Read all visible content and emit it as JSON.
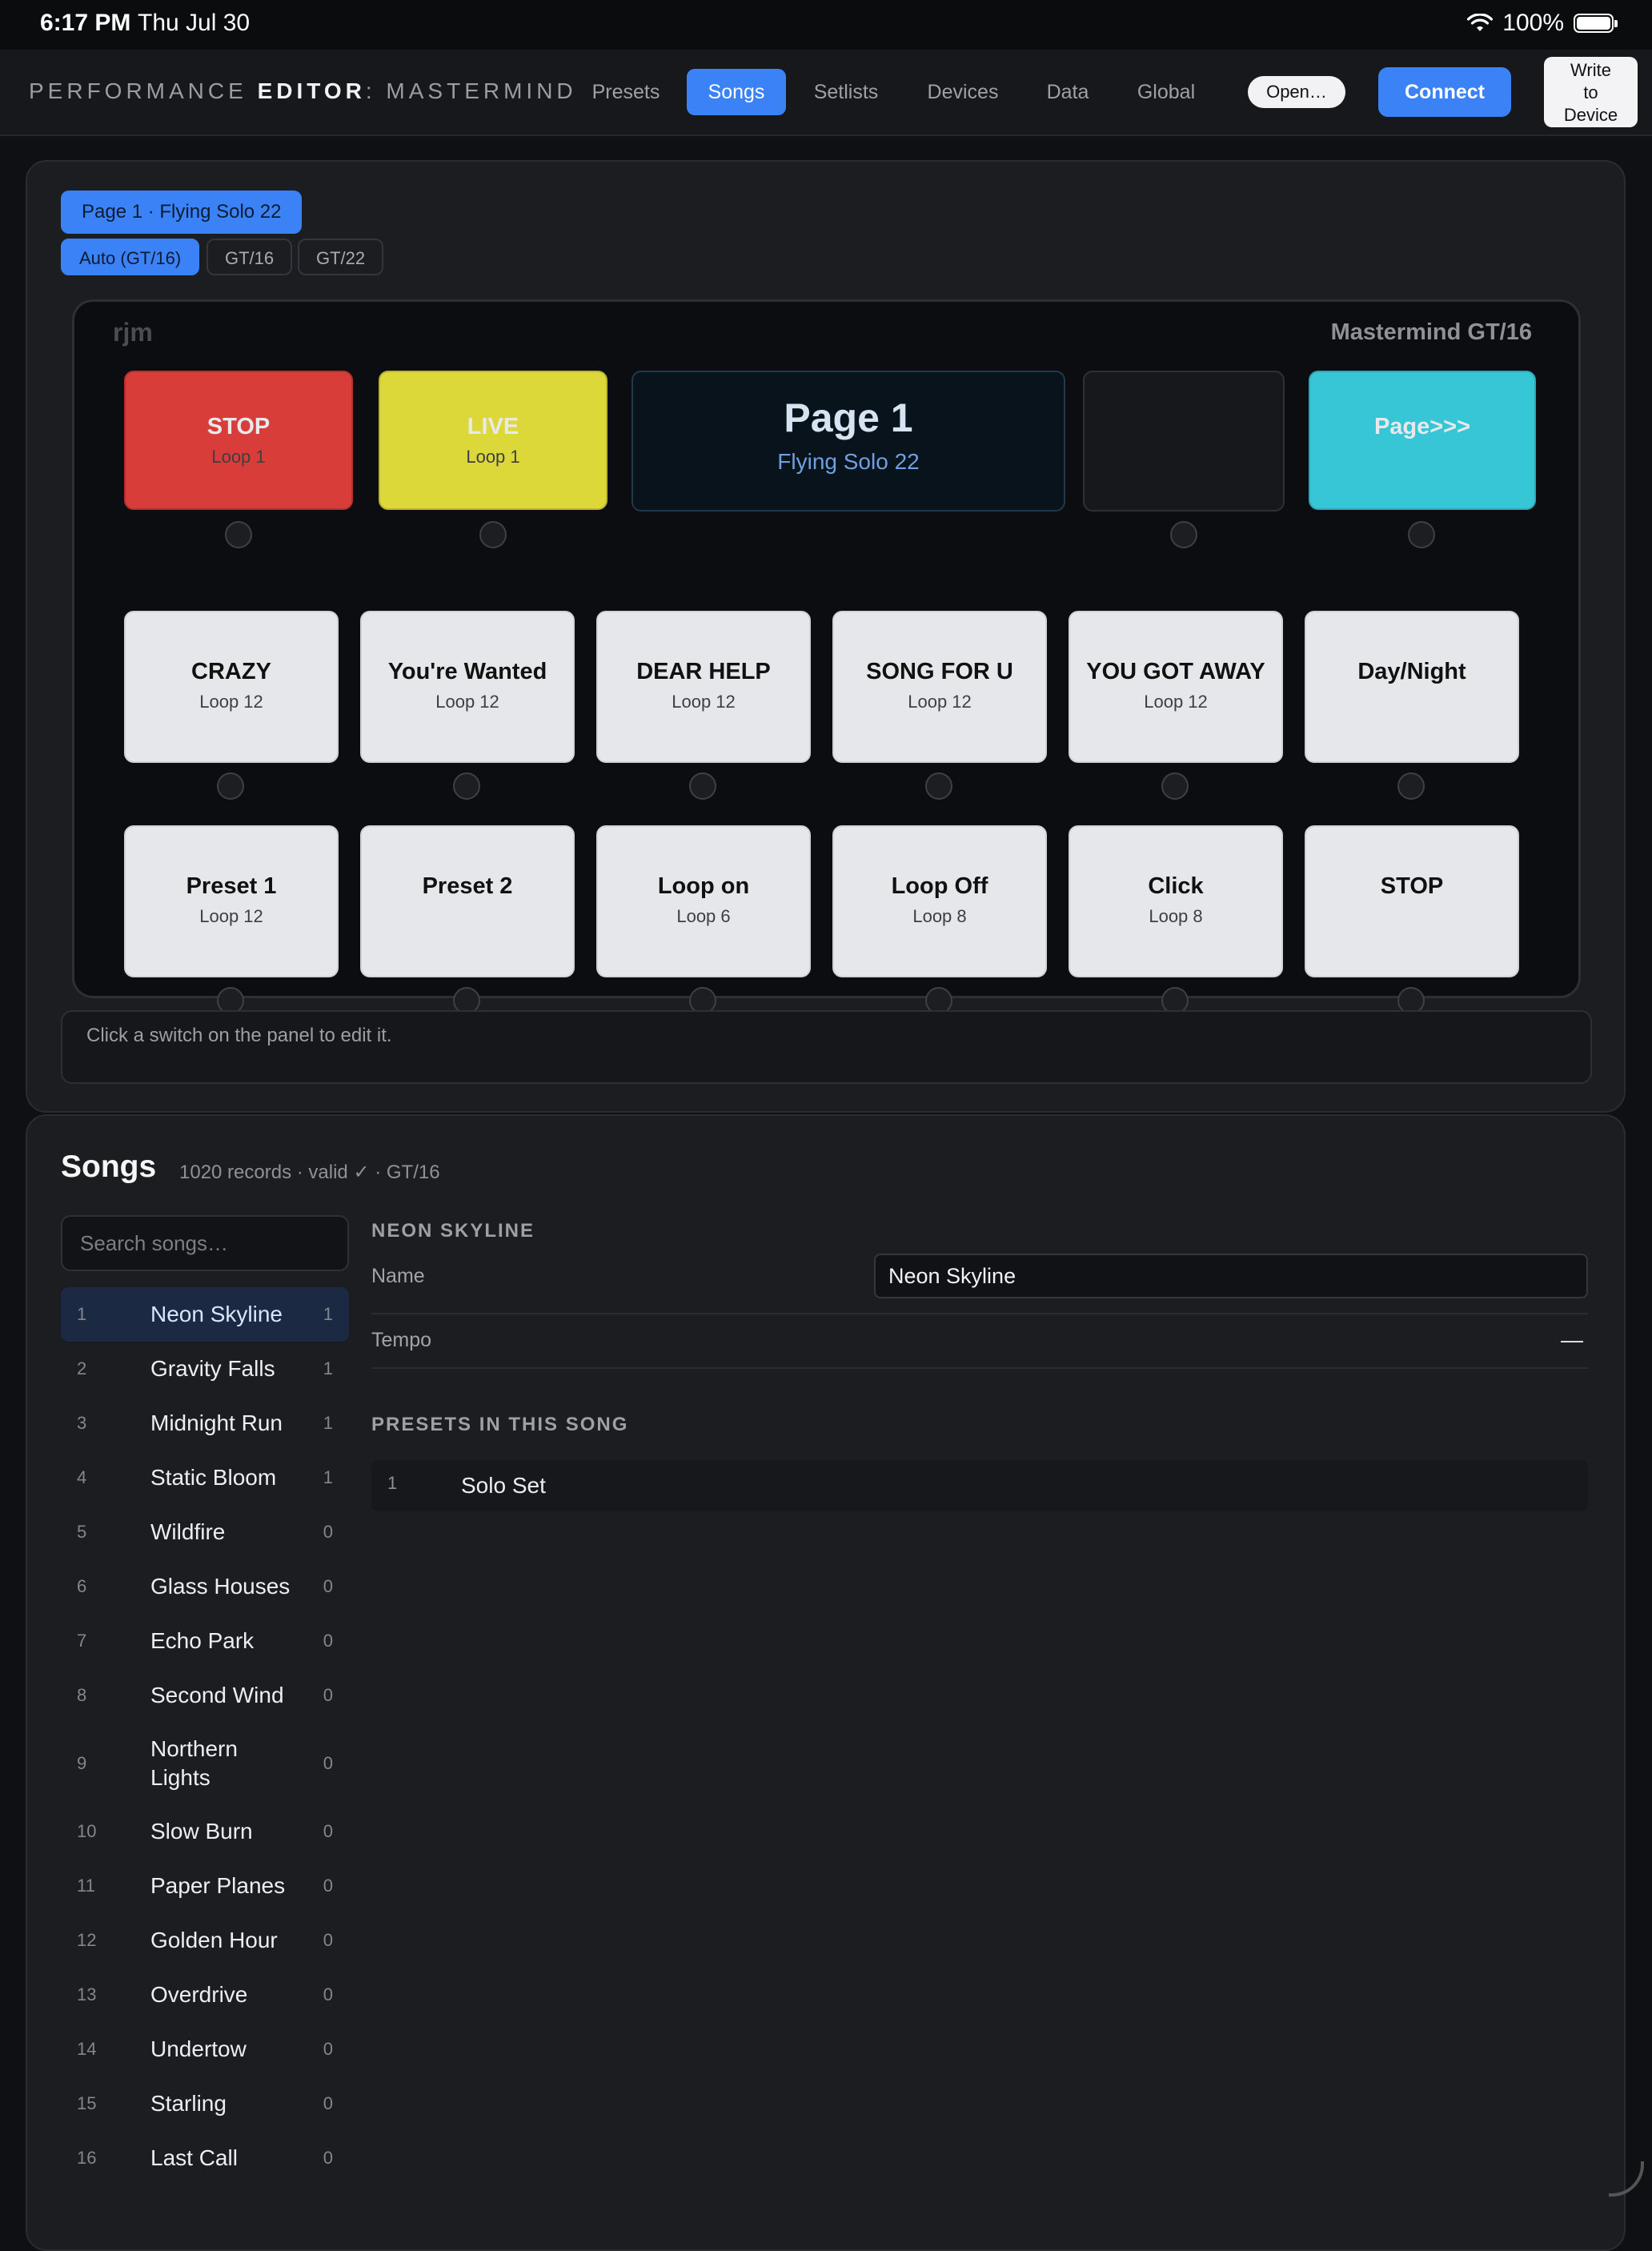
{
  "status_bar": {
    "time": "6:17 PM",
    "date": "Thu Jul 30",
    "battery": "100%"
  },
  "nav": {
    "brand_prefix": "PERFORMANCE ",
    "brand_bold": "EDITOR",
    "brand_suffix": ": MASTERMIND",
    "tabs": [
      "Presets",
      "Songs",
      "Setlists",
      "Devices",
      "Data",
      "Global"
    ],
    "active_tab": "Songs",
    "open_button": "Open…",
    "connect_button": "Connect",
    "write_button": "Write\nto\nDevice"
  },
  "panel": {
    "page_chip": "Page 1 · Flying Solo 22",
    "device_tabs": [
      "Auto (GT/16)",
      "GT/16",
      "GT/22"
    ],
    "brand_mark": "rjm",
    "model": "Mastermind GT/16",
    "top_row": [
      {
        "label": "STOP",
        "sub": "Loop 1",
        "color": "#d93d3a"
      },
      {
        "label": "LIVE",
        "sub": "Loop 1",
        "color": "#dcd83a"
      },
      {
        "label": "",
        "sub": "",
        "color": "#17181c"
      },
      {
        "label": "Page>>>",
        "sub": "",
        "color": "#36c6d6"
      }
    ],
    "display": {
      "title": "Page 1",
      "subtitle": "Flying Solo 22"
    },
    "row2": [
      {
        "label": "CRAZY",
        "sub": "Loop 12"
      },
      {
        "label": "You're Wanted",
        "sub": "Loop 12"
      },
      {
        "label": "DEAR HELP",
        "sub": "Loop 12"
      },
      {
        "label": "SONG FOR U",
        "sub": "Loop 12"
      },
      {
        "label": "YOU GOT AWAY",
        "sub": "Loop 12"
      },
      {
        "label": "Day/Night",
        "sub": ""
      }
    ],
    "row3": [
      {
        "label": "Preset 1",
        "sub": "Loop 12"
      },
      {
        "label": "Preset 2",
        "sub": ""
      },
      {
        "label": "Loop on",
        "sub": "Loop 6"
      },
      {
        "label": "Loop Off",
        "sub": "Loop 8"
      },
      {
        "label": "Click",
        "sub": "Loop 8"
      },
      {
        "label": "STOP",
        "sub": ""
      }
    ],
    "hint": "Click a switch on the panel to edit it."
  },
  "songs": {
    "title": "Songs",
    "meta": "1020 records · valid ✓ · GT/16",
    "search_placeholder": "Search songs…",
    "items": [
      {
        "num": "1",
        "name": "Neon Skyline",
        "count": "1"
      },
      {
        "num": "2",
        "name": "Gravity Falls",
        "count": "1"
      },
      {
        "num": "3",
        "name": "Midnight Run",
        "count": "1"
      },
      {
        "num": "4",
        "name": "Static Bloom",
        "count": "1"
      },
      {
        "num": "5",
        "name": "Wildfire",
        "count": "0"
      },
      {
        "num": "6",
        "name": "Glass Houses",
        "count": "0"
      },
      {
        "num": "7",
        "name": "Echo Park",
        "count": "0"
      },
      {
        "num": "8",
        "name": "Second Wind",
        "count": "0"
      },
      {
        "num": "9",
        "name": "Northern Lights",
        "count": "0"
      },
      {
        "num": "10",
        "name": "Slow Burn",
        "count": "0"
      },
      {
        "num": "11",
        "name": "Paper Planes",
        "count": "0"
      },
      {
        "num": "12",
        "name": "Golden Hour",
        "count": "0"
      },
      {
        "num": "13",
        "name": "Overdrive",
        "count": "0"
      },
      {
        "num": "14",
        "name": "Undertow",
        "count": "0"
      },
      {
        "num": "15",
        "name": "Starling",
        "count": "0"
      },
      {
        "num": "16",
        "name": "Last Call",
        "count": "0"
      }
    ],
    "detail": {
      "heading": "NEON SKYLINE",
      "name_label": "Name",
      "name_value": "Neon Skyline",
      "tempo_label": "Tempo",
      "tempo_value": "—",
      "presets_heading": "PRESETS IN THIS SONG",
      "presets": [
        {
          "num": "1",
          "name": "Solo Set"
        }
      ]
    }
  }
}
